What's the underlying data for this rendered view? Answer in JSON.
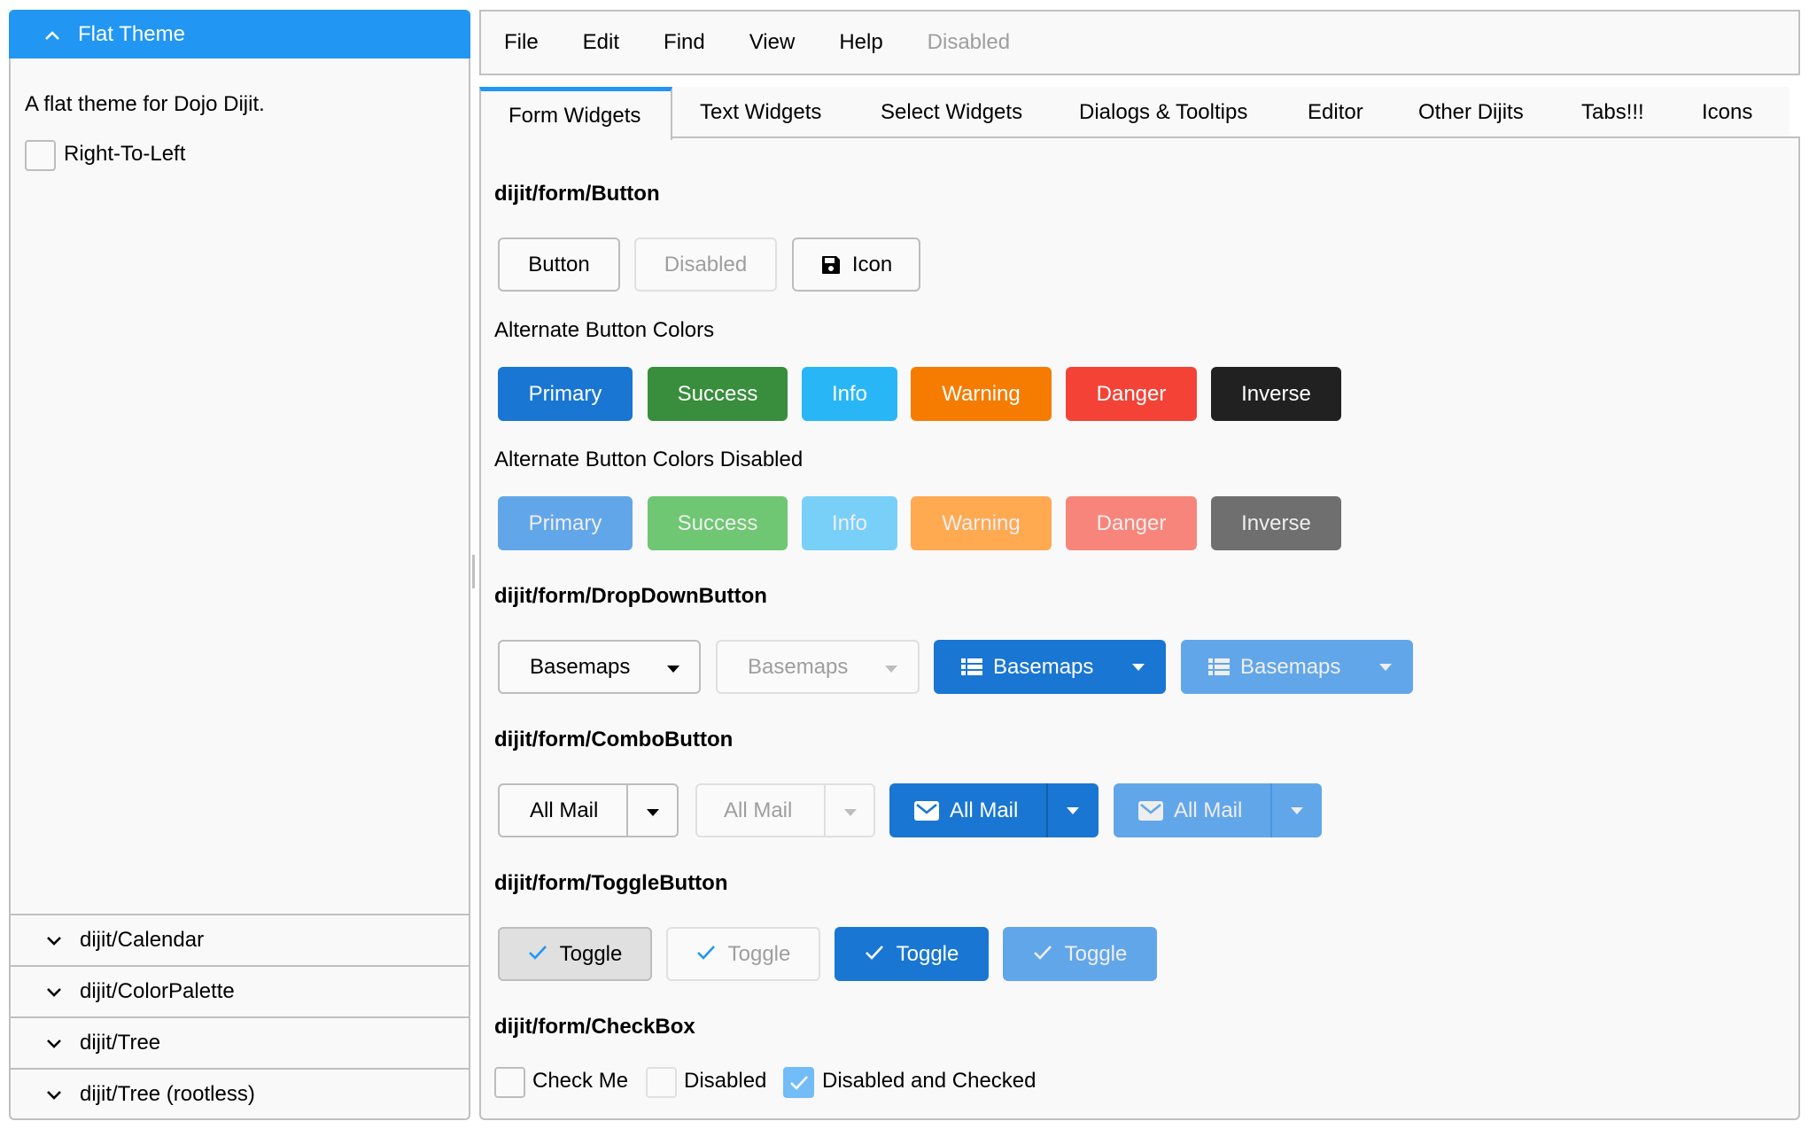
{
  "sidebar": {
    "header": {
      "title": "Flat Theme",
      "icon": "chevron-up-icon"
    },
    "description": "A flat theme for Dojo Dijit.",
    "rtl_checkbox": {
      "label": "Right-To-Left",
      "checked": false
    },
    "sections": [
      {
        "label": "dijit/Calendar",
        "icon": "chevron-down-icon"
      },
      {
        "label": "dijit/ColorPalette",
        "icon": "chevron-down-icon"
      },
      {
        "label": "dijit/Tree",
        "icon": "chevron-down-icon"
      },
      {
        "label": "dijit/Tree (rootless)",
        "icon": "chevron-down-icon"
      }
    ]
  },
  "menubar": {
    "items": [
      {
        "label": "File",
        "disabled": false
      },
      {
        "label": "Edit",
        "disabled": false
      },
      {
        "label": "Find",
        "disabled": false
      },
      {
        "label": "View",
        "disabled": false
      },
      {
        "label": "Help",
        "disabled": false
      },
      {
        "label": "Disabled",
        "disabled": true
      }
    ]
  },
  "tabs": {
    "active": "Form Widgets",
    "items": [
      {
        "label": "Form Widgets"
      },
      {
        "label": "Text Widgets"
      },
      {
        "label": "Select Widgets"
      },
      {
        "label": "Dialogs & Tooltips"
      },
      {
        "label": "Editor"
      },
      {
        "label": "Other Dijits"
      },
      {
        "label": "Tabs!!!"
      },
      {
        "label": "Icons"
      }
    ]
  },
  "colors": {
    "accent": "#2196F3",
    "primary": "#1976D2",
    "success": "#388E3C",
    "info": "#29B6F6",
    "warning": "#F57C00",
    "danger": "#F44336",
    "inverse": "#212121",
    "primary_disabled": "#62A6EA",
    "success_disabled": "#6FC773",
    "info_disabled": "#78D0F9",
    "warning_disabled": "#FFA951",
    "danger_disabled": "#F8857B",
    "inverse_disabled": "#6F6F6F"
  },
  "content": {
    "button_section": {
      "heading": "dijit/form/Button",
      "buttons": [
        {
          "label": "Button",
          "disabled": false
        },
        {
          "label": "Disabled",
          "disabled": true
        },
        {
          "label": "Icon",
          "icon": "save-icon",
          "disabled": false
        }
      ],
      "alt_heading": "Alternate Button Colors",
      "alt_buttons": [
        "Primary",
        "Success",
        "Info",
        "Warning",
        "Danger",
        "Inverse"
      ],
      "alt_disabled_heading": "Alternate Button Colors Disabled",
      "alt_disabled_buttons": [
        "Primary",
        "Success",
        "Info",
        "Warning",
        "Danger",
        "Inverse"
      ]
    },
    "dropdown_section": {
      "heading": "dijit/form/DropDownButton",
      "buttons": [
        {
          "label": "Basemaps",
          "style": "default",
          "disabled": false
        },
        {
          "label": "Basemaps",
          "style": "default",
          "disabled": true
        },
        {
          "label": "Basemaps",
          "style": "primary",
          "icon": "list-icon",
          "disabled": false
        },
        {
          "label": "Basemaps",
          "style": "primary",
          "icon": "list-icon",
          "disabled": true
        }
      ]
    },
    "combo_section": {
      "heading": "dijit/form/ComboButton",
      "buttons": [
        {
          "label": "All Mail",
          "style": "default",
          "disabled": false
        },
        {
          "label": "All Mail",
          "style": "default",
          "disabled": true
        },
        {
          "label": "All Mail",
          "style": "primary",
          "icon": "mail-icon",
          "disabled": false
        },
        {
          "label": "All Mail",
          "style": "primary",
          "icon": "mail-icon",
          "disabled": true
        }
      ]
    },
    "toggle_section": {
      "heading": "dijit/form/ToggleButton",
      "buttons": [
        {
          "label": "Toggle",
          "style": "default",
          "checked": true,
          "disabled": false
        },
        {
          "label": "Toggle",
          "style": "default",
          "checked": true,
          "disabled": true
        },
        {
          "label": "Toggle",
          "style": "primary",
          "checked": true,
          "disabled": false
        },
        {
          "label": "Toggle",
          "style": "primary",
          "checked": true,
          "disabled": true
        }
      ]
    },
    "checkbox_section": {
      "heading": "dijit/form/CheckBox",
      "items": [
        {
          "label": "Check Me",
          "checked": false,
          "disabled": false
        },
        {
          "label": "Disabled",
          "checked": false,
          "disabled": true
        },
        {
          "label": "Disabled and Checked",
          "checked": true,
          "disabled": true
        }
      ]
    }
  }
}
